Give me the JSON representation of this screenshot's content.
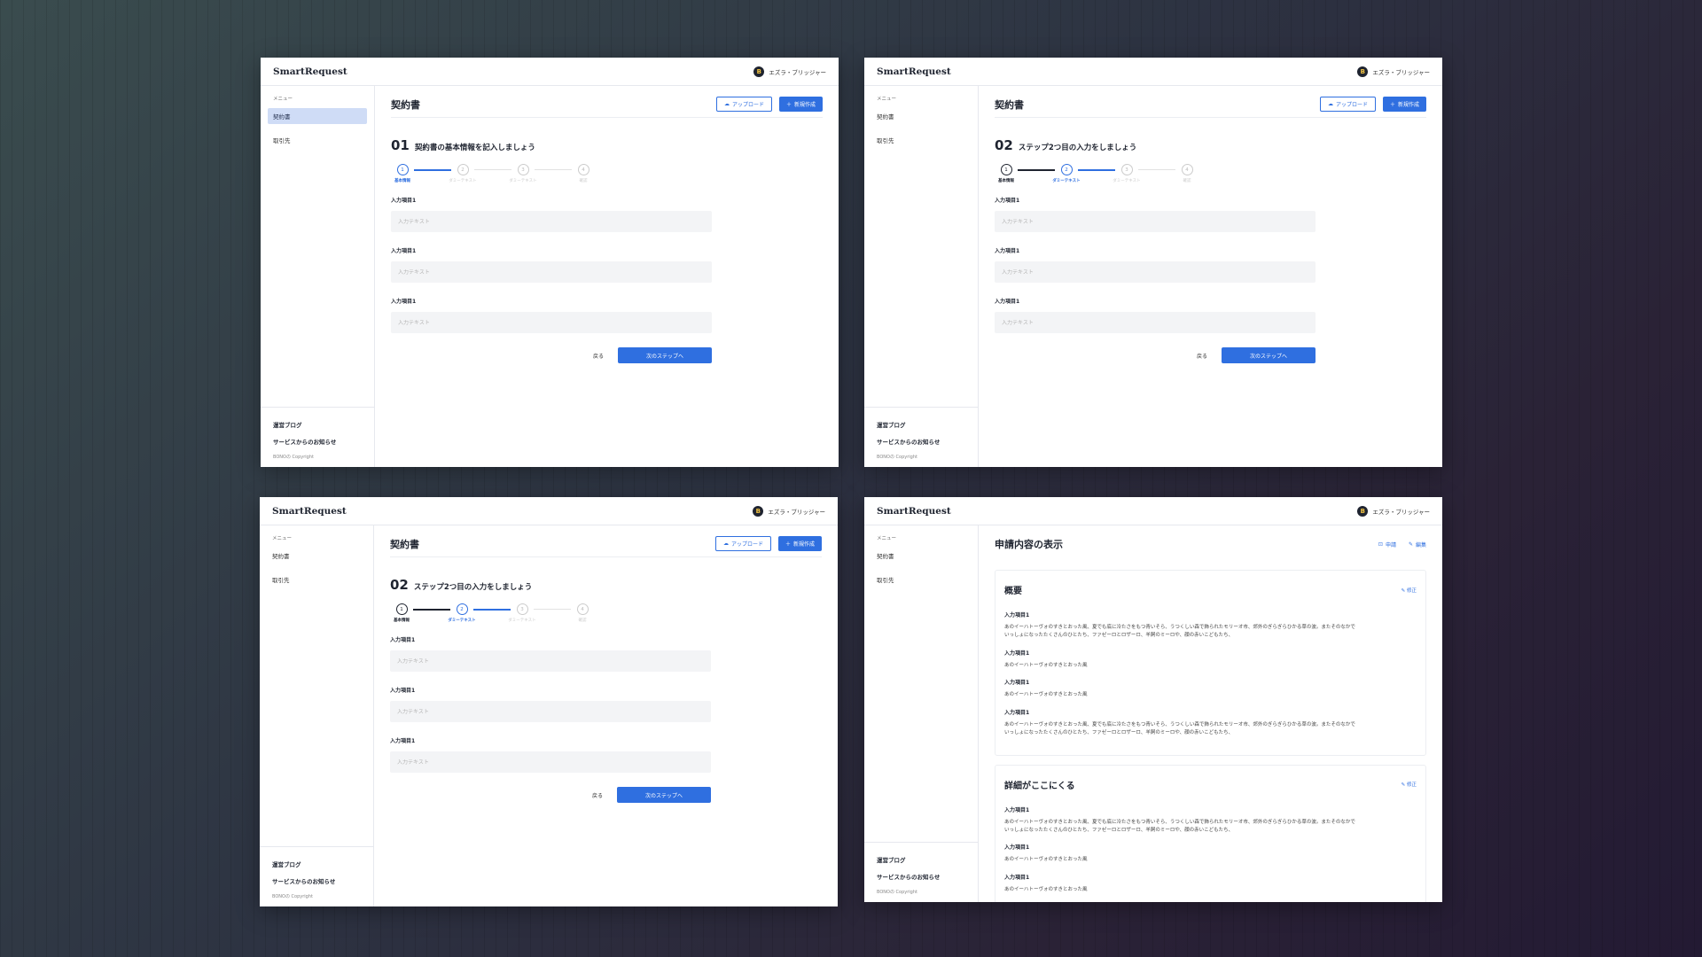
{
  "app": {
    "logo": "SmartRequest",
    "user_name": "エズラ・ブリッジャー",
    "avatar_letter": "B"
  },
  "sidebar": {
    "menu_header": "メニュー",
    "items": [
      "契約書",
      "取引先"
    ],
    "footer_links": [
      "運営ブログ",
      "サービスからのお知らせ"
    ],
    "copyright": "BONOの Copyright"
  },
  "form": {
    "page_title": "契約書",
    "upload_label": "アップロード",
    "new_label": "新規作成",
    "field_label": "入力項目1",
    "placeholder": "入力テキスト",
    "back_label": "戻る",
    "next_label": "次のステップへ",
    "steps": [
      "基本情報",
      "ダミーテキスト",
      "ダミーテキスト",
      "確認"
    ],
    "step1": {
      "number": "01",
      "title": "契約書の基本情報を記入しましょう"
    },
    "step2": {
      "number": "02",
      "title": "ステップ2つ目の入力をしましょう"
    }
  },
  "review": {
    "page_title": "申請内容の表示",
    "apply_label": "申請",
    "edit_label": "編集",
    "card_edit_label": "修正",
    "cards": [
      {
        "title": "概要",
        "items": [
          {
            "label": "入力項目1",
            "value": "あのイーハトーヴォのすきとおった風、夏でも底に冷たさをもつ青いそら、うつくしい森で飾られたモリーオ市、郊外のぎらぎらひかる草の波。またそのなかでいっしょになったたくさんのひとたち、ファゼーロとロザーロ、羊飼のミーロや、顔の赤いこどもたち、"
          },
          {
            "label": "入力項目1",
            "value": "あのイーハトーヴォのすきとおった風"
          },
          {
            "label": "入力項目1",
            "value": "あのイーハトーヴォのすきとおった風"
          },
          {
            "label": "入力項目1",
            "value": "あのイーハトーヴォのすきとおった風、夏でも底に冷たさをもつ青いそら、うつくしい森で飾られたモリーオ市、郊外のぎらぎらひかる草の波。またそのなかでいっしょになったたくさんのひとたち、ファゼーロとロザーロ、羊飼のミーロや、顔の赤いこどもたち、"
          }
        ]
      },
      {
        "title": "詳細がここにくる",
        "items": [
          {
            "label": "入力項目1",
            "value": "あのイーハトーヴォのすきとおった風、夏でも底に冷たさをもつ青いそら、うつくしい森で飾られたモリーオ市、郊外のぎらぎらひかる草の波。またそのなかでいっしょになったたくさんのひとたち、ファゼーロとロザーロ、羊飼のミーロや、顔の赤いこどもたち、"
          },
          {
            "label": "入力項目1",
            "value": "あのイーハトーヴォのすきとおった風"
          },
          {
            "label": "入力項目1",
            "value": "あのイーハトーヴォのすきとおった風"
          }
        ]
      }
    ]
  },
  "colors": {
    "accent": "#2f6fe0",
    "text": "#1f2430",
    "active_bg": "#cfdcf6"
  }
}
